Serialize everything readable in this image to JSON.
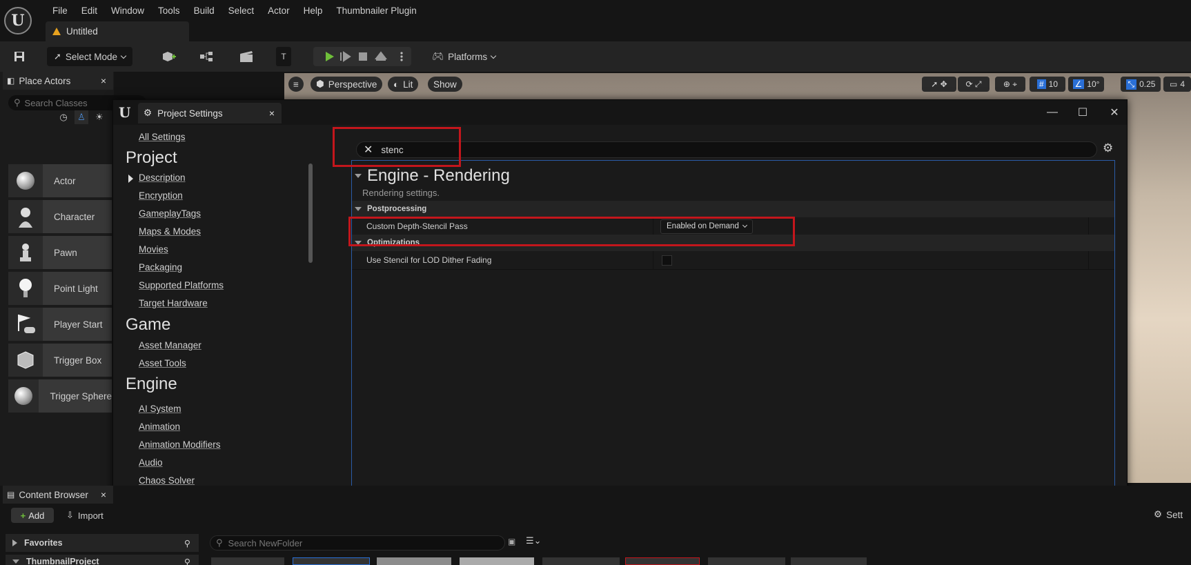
{
  "menu": {
    "items": [
      "File",
      "Edit",
      "Window",
      "Tools",
      "Build",
      "Select",
      "Actor",
      "Help",
      "Thumbnailer Plugin"
    ],
    "level_tab": "Untitled"
  },
  "toolbar": {
    "select_mode": "Select Mode",
    "platforms": "Platforms"
  },
  "place_actors": {
    "tab_label": "Place Actors",
    "search_placeholder": "Search Classes",
    "items": [
      "Actor",
      "Character",
      "Pawn",
      "Point Light",
      "Player Start",
      "Trigger Box",
      "Trigger Sphere"
    ]
  },
  "viewport": {
    "perspective": "Perspective",
    "lit": "Lit",
    "show": "Show",
    "grid_snap": "10",
    "rot_snap": "10°",
    "scale_snap": "0.25",
    "camera_speed": "4"
  },
  "project_settings": {
    "tab_label": "Project Settings",
    "nav": {
      "all_settings": "All Settings",
      "sections": [
        {
          "heading": "Project",
          "links": [
            "Description",
            "Encryption",
            "GameplayTags",
            "Maps & Modes",
            "Movies",
            "Packaging",
            "Supported Platforms",
            "Target Hardware"
          ]
        },
        {
          "heading": "Game",
          "links": [
            "Asset Manager",
            "Asset Tools"
          ]
        },
        {
          "heading": "Engine",
          "links": [
            "AI System",
            "Animation",
            "Animation Modifiers",
            "Audio",
            "Chaos Solver"
          ]
        }
      ]
    },
    "search_value": "stenc",
    "details": {
      "title": "Engine - Rendering",
      "subtitle": "Rendering settings.",
      "categories": [
        {
          "name": "Postprocessing",
          "property": "Custom Depth-Stencil Pass",
          "value": "Enabled on Demand"
        },
        {
          "name": "Optimizations",
          "property": "Use Stencil for LOD Dither Fading",
          "value": ""
        }
      ]
    }
  },
  "content_browser": {
    "tab_label": "Content Browser",
    "add": "Add",
    "import": "Import",
    "favorites": "Favorites",
    "project": "ThumbnailProject",
    "search_placeholder": "Search NewFolder",
    "settings": "Sett"
  },
  "colors": {
    "accent_red": "#c3161c",
    "selection_blue": "#2a5ca8",
    "play_green": "#6fbf3a"
  }
}
